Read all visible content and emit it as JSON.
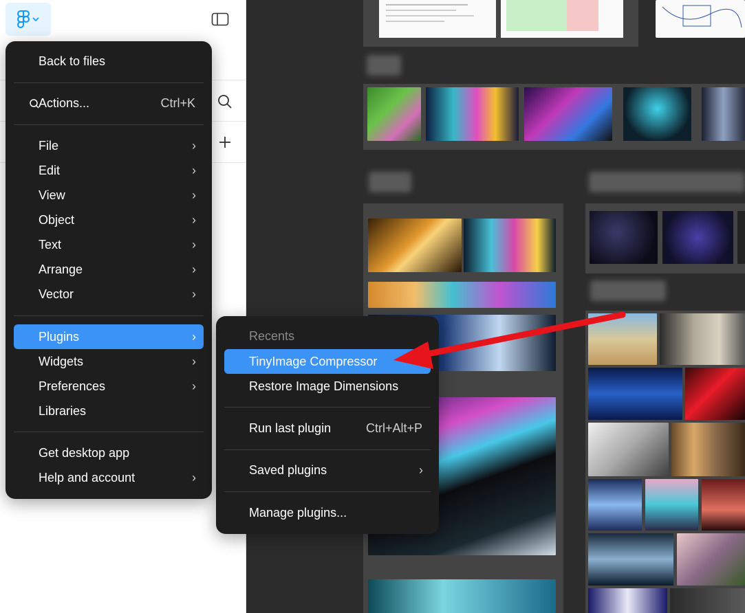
{
  "main_menu": {
    "back_to_files": "Back to files",
    "actions": {
      "label": "Actions...",
      "shortcut": "Ctrl+K"
    },
    "items": [
      {
        "label": "File"
      },
      {
        "label": "Edit"
      },
      {
        "label": "View"
      },
      {
        "label": "Object"
      },
      {
        "label": "Text"
      },
      {
        "label": "Arrange"
      },
      {
        "label": "Vector"
      }
    ],
    "plugins": "Plugins",
    "widgets": "Widgets",
    "preferences": "Preferences",
    "libraries": "Libraries",
    "get_desktop_app": "Get desktop app",
    "help_and_account": "Help and account"
  },
  "plugins_menu": {
    "recents_heading": "Recents",
    "recent_items": [
      "TinyImage Compressor",
      "Restore Image Dimensions"
    ],
    "run_last": {
      "label": "Run last plugin",
      "shortcut": "Ctrl+Alt+P"
    },
    "saved_plugins": "Saved plugins",
    "manage_plugins": "Manage plugins..."
  },
  "icons": {
    "chevron": "›"
  },
  "colors": {
    "accent": "#3b93f5",
    "menu_bg": "#1e1e1e",
    "annotation_arrow": "#e8141b"
  }
}
